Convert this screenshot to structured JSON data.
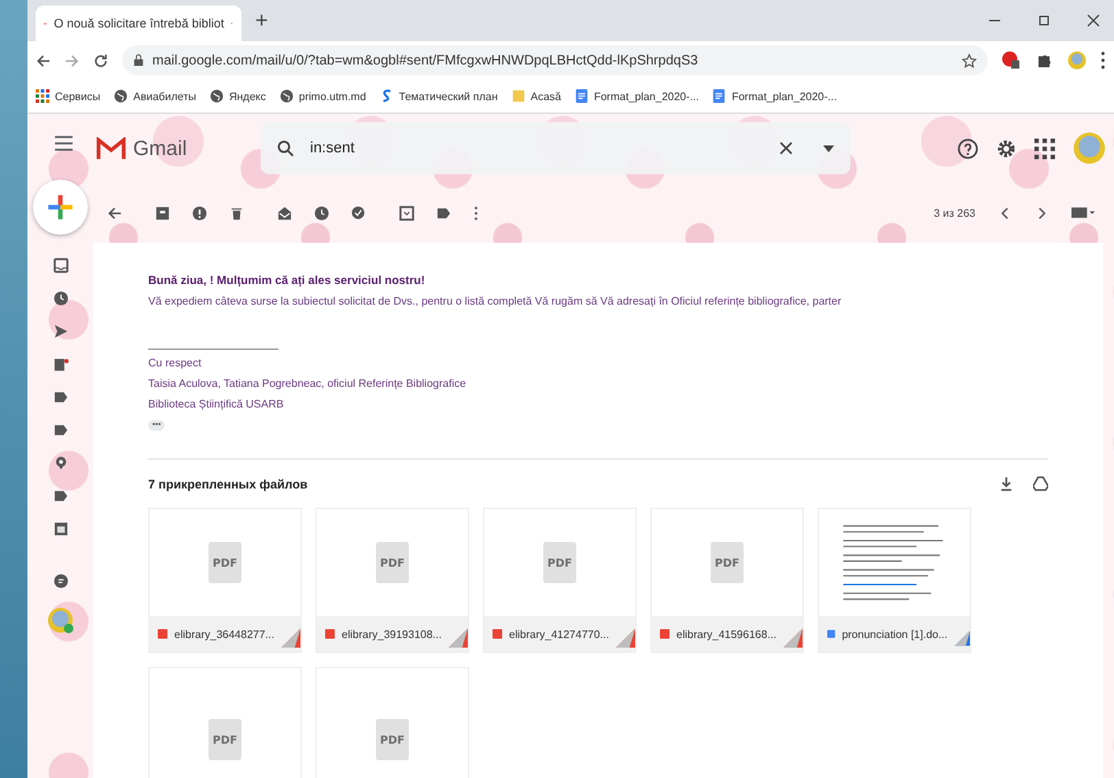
{
  "browser": {
    "tab_title": "O nouă solicitare întrebă bibliot",
    "new_tab": "+",
    "url": "mail.google.com/mail/u/0/?tab=wm&ogbl#sent/FMfcgxwHNWDpqLBHctQdd-lKpShrpdqS3",
    "bookmarks": [
      {
        "kind": "apps",
        "label": "Сервисы"
      },
      {
        "kind": "globe",
        "label": "Авиабилеты"
      },
      {
        "kind": "globe",
        "label": "Яндекс"
      },
      {
        "kind": "globe",
        "label": "primo.utm.md"
      },
      {
        "kind": "s",
        "label": "Тематический план"
      },
      {
        "kind": "folder",
        "label": "Acasă"
      },
      {
        "kind": "doc",
        "label": "Format_plan_2020-..."
      },
      {
        "kind": "doc",
        "label": "Format_plan_2020-..."
      }
    ]
  },
  "gmail": {
    "logo": "Gmail",
    "search": {
      "value": "in:sent"
    },
    "pager": "3 из 263"
  },
  "email": {
    "greeting": "Bună ziua, ! Mulțumim că ați ales serviciul nostru!",
    "body": "Vă expediem câteva surse la subiectul solicitat de Dvs., pentru o listă completă Vă rugăm să Vă adresați în Oficiul referințe bibliografice, parter",
    "signature": [
      "Cu respect",
      "Taisia Aculova, Tatiana Pogrebneac, oficiul Referințe Bibliografice",
      "Biblioteca Științifică USARB"
    ],
    "ellipsis": "•••"
  },
  "attachments": {
    "title": "7 прикрепленных файлов",
    "files": [
      {
        "kind": "pdf",
        "thumb_label": "PDF",
        "name": "elibrary_36448277..."
      },
      {
        "kind": "pdf",
        "thumb_label": "PDF",
        "name": "elibrary_39193108..."
      },
      {
        "kind": "pdf",
        "thumb_label": "PDF",
        "name": "elibrary_41274770..."
      },
      {
        "kind": "pdf",
        "thumb_label": "PDF",
        "name": "elibrary_41596168..."
      },
      {
        "kind": "doc",
        "name": "pronunciation [1].do..."
      },
      {
        "kind": "pdf",
        "thumb_label": "PDF"
      },
      {
        "kind": "pdf",
        "thumb_label": "PDF"
      }
    ]
  }
}
